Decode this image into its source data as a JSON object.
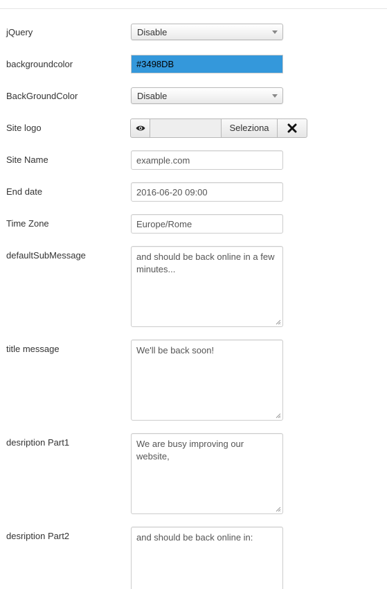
{
  "accent_color": "#3498DB",
  "fields": {
    "jquery": {
      "label": "jQuery",
      "value": "Disable"
    },
    "backgroundcolor": {
      "label": "backgroundcolor",
      "value": "#3498DB"
    },
    "background_color_select": {
      "label": "BackGroundColor",
      "value": "Disable"
    },
    "site_logo": {
      "label": "Site logo",
      "select_label": "Seleziona",
      "preview_icon": "eye-icon",
      "clear_icon": "close-icon"
    },
    "site_name": {
      "label": "Site Name",
      "value": "example.com"
    },
    "end_date": {
      "label": "End date",
      "value": "2016-06-20 09:00"
    },
    "time_zone": {
      "label": "Time Zone",
      "value": "Europe/Rome"
    },
    "default_sub_message": {
      "label": "defaultSubMessage",
      "value": "and should be back online in a few minutes..."
    },
    "title_message": {
      "label": "title message",
      "value": "We'll be back soon!"
    },
    "description_part1": {
      "label": "desription Part1",
      "value": "We are busy improving our website,"
    },
    "description_part2": {
      "label": "desription Part2",
      "value": "and should be back online in:"
    }
  }
}
